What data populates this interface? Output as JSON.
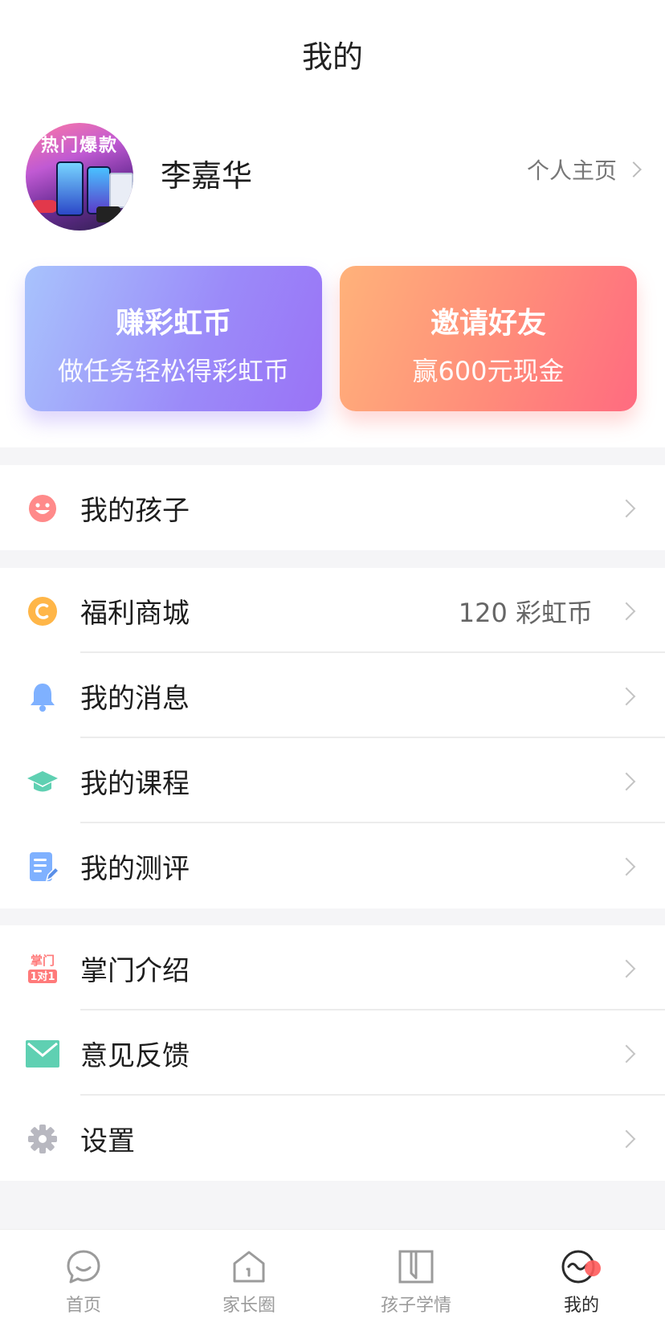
{
  "header": {
    "title": "我的"
  },
  "profile": {
    "name": "李嘉华",
    "homepage_label": "个人主页",
    "avatar_banner": "热门爆款"
  },
  "promos": [
    {
      "title": "赚彩虹币",
      "subtitle": "做任务轻松得彩虹币",
      "colors": [
        "#a8c3fc",
        "#9a73f6"
      ]
    },
    {
      "title": "邀请好友",
      "subtitle": "赢600元现金",
      "colors": [
        "#ffb27a",
        "#ff6b80"
      ]
    }
  ],
  "groups": [
    {
      "items": [
        {
          "label": "我的孩子",
          "icon": "smile-face-icon"
        }
      ]
    },
    {
      "items": [
        {
          "label": "福利商城",
          "icon": "coin-icon",
          "value": "120 彩虹币"
        },
        {
          "label": "我的消息",
          "icon": "bell-icon"
        },
        {
          "label": "我的课程",
          "icon": "graduation-cap-icon"
        },
        {
          "label": "我的测评",
          "icon": "document-edit-icon"
        }
      ]
    },
    {
      "items": [
        {
          "label": "掌门介绍",
          "icon": "zhangmen-logo-icon",
          "icon_text_top": "掌门",
          "icon_text_bottom": "1对1"
        },
        {
          "label": "意见反馈",
          "icon": "envelope-icon"
        },
        {
          "label": "设置",
          "icon": "gear-icon"
        }
      ]
    }
  ],
  "tabbar": {
    "tabs": [
      {
        "label": "首页",
        "icon": "chat-bubble-icon",
        "active": false
      },
      {
        "label": "家长圈",
        "icon": "house-icon",
        "active": false
      },
      {
        "label": "孩子学情",
        "icon": "book-icon",
        "active": false
      },
      {
        "label": "我的",
        "icon": "face-icon",
        "active": true
      }
    ]
  },
  "colors": {
    "accent_purple": "#9a73f6",
    "accent_orange": "#ff8c7a",
    "coin": "#ffb648",
    "bell": "#7fb1ff",
    "cap": "#5fd0b2",
    "doc": "#7fb1ff",
    "envelope": "#5fd0b2",
    "gear": "#b8b8c0",
    "badge_red": "#ff5b5b"
  }
}
